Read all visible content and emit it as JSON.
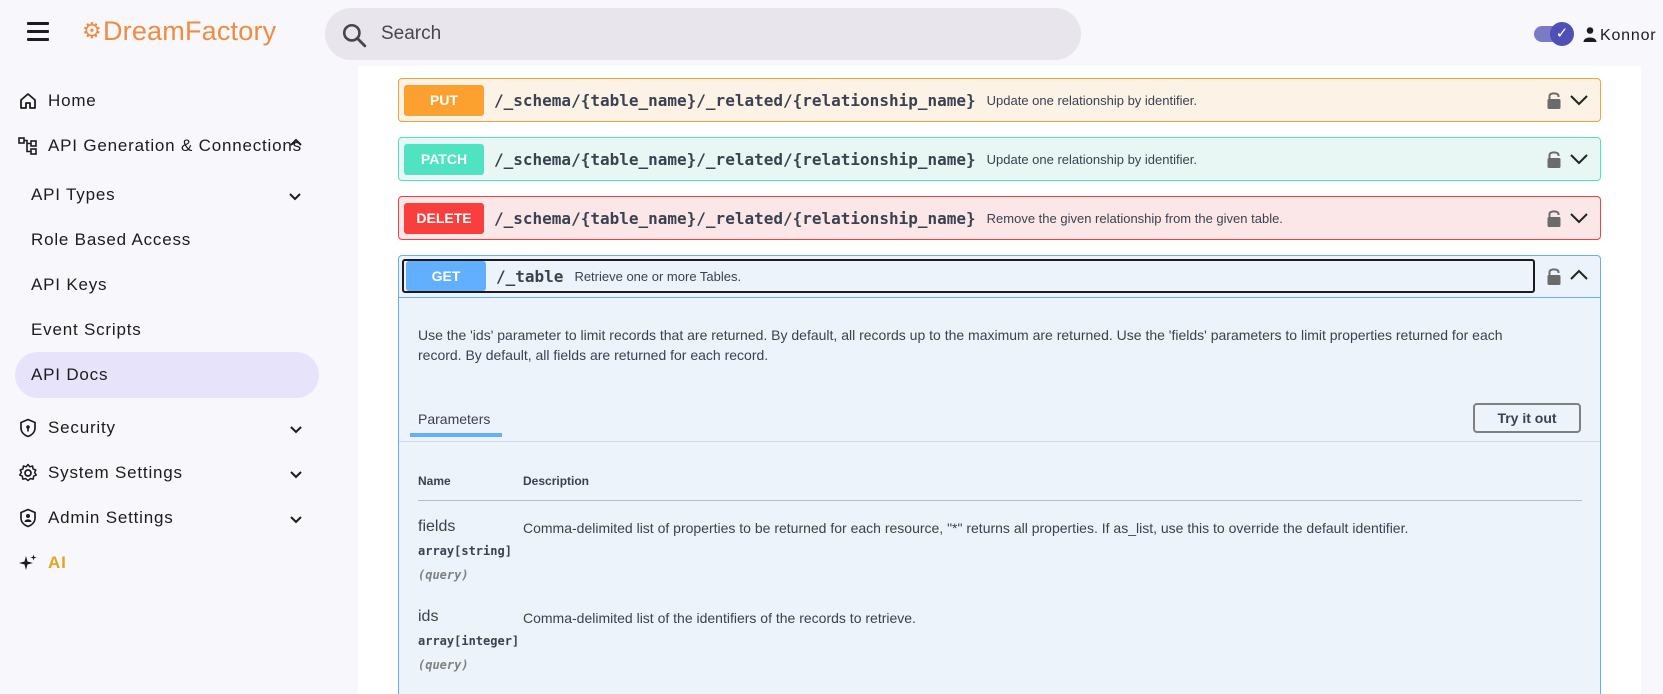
{
  "app": {
    "brand": "DreamFactory",
    "user_name": "Konnor"
  },
  "search": {
    "placeholder": "Search"
  },
  "sidebar": {
    "home": "Home",
    "api_gen": "API Generation & Connections",
    "sub_items": [
      "API Types",
      "Role Based Access",
      "API Keys",
      "Event Scripts",
      "API Docs"
    ],
    "security": "Security",
    "system_settings": "System Settings",
    "admin_settings": "Admin Settings",
    "ai": "AI"
  },
  "operations": [
    {
      "method": "PUT",
      "path": "/_schema/{table_name}/_related/{relationship_name}",
      "summary": "Update one relationship by identifier."
    },
    {
      "method": "PATCH",
      "path": "/_schema/{table_name}/_related/{relationship_name}",
      "summary": "Update one relationship by identifier."
    },
    {
      "method": "DELETE",
      "path": "/_schema/{table_name}/_related/{relationship_name}",
      "summary": "Remove the given relationship from the given table."
    }
  ],
  "open_operation": {
    "method": "GET",
    "path": "/_table",
    "summary": "Retrieve one or more Tables.",
    "description": "Use the 'ids' parameter to limit records that are returned. By default, all records up to the maximum are returned. Use the 'fields' parameters to limit properties returned for each record. By default, all fields are returned for each record.",
    "tab_label": "Parameters",
    "try_label": "Try it out",
    "col_name": "Name",
    "col_desc": "Description",
    "params": [
      {
        "name": "fields",
        "type": "array[string]",
        "in": "(query)",
        "description": "Comma-delimited list of properties to be returned for each resource, \"*\" returns all properties. If as_list, use this to override the default identifier."
      },
      {
        "name": "ids",
        "type": "array[integer]",
        "in": "(query)",
        "description": "Comma-delimited list of the identifiers of the records to retrieve."
      }
    ]
  },
  "colors": {
    "put": "#fca130",
    "patch": "#50e3c2",
    "delete": "#f93e3e",
    "get": "#61affe",
    "brand": "#f08c40",
    "active_nav": "#e6e3fb"
  },
  "icons": [
    "menu-icon",
    "search-icon",
    "theme-toggle-icon",
    "user-icon",
    "home-icon",
    "api-icon",
    "security-icon",
    "settings-icon",
    "admin-icon",
    "ai-icon",
    "lock-icon",
    "chevron-icon"
  ]
}
